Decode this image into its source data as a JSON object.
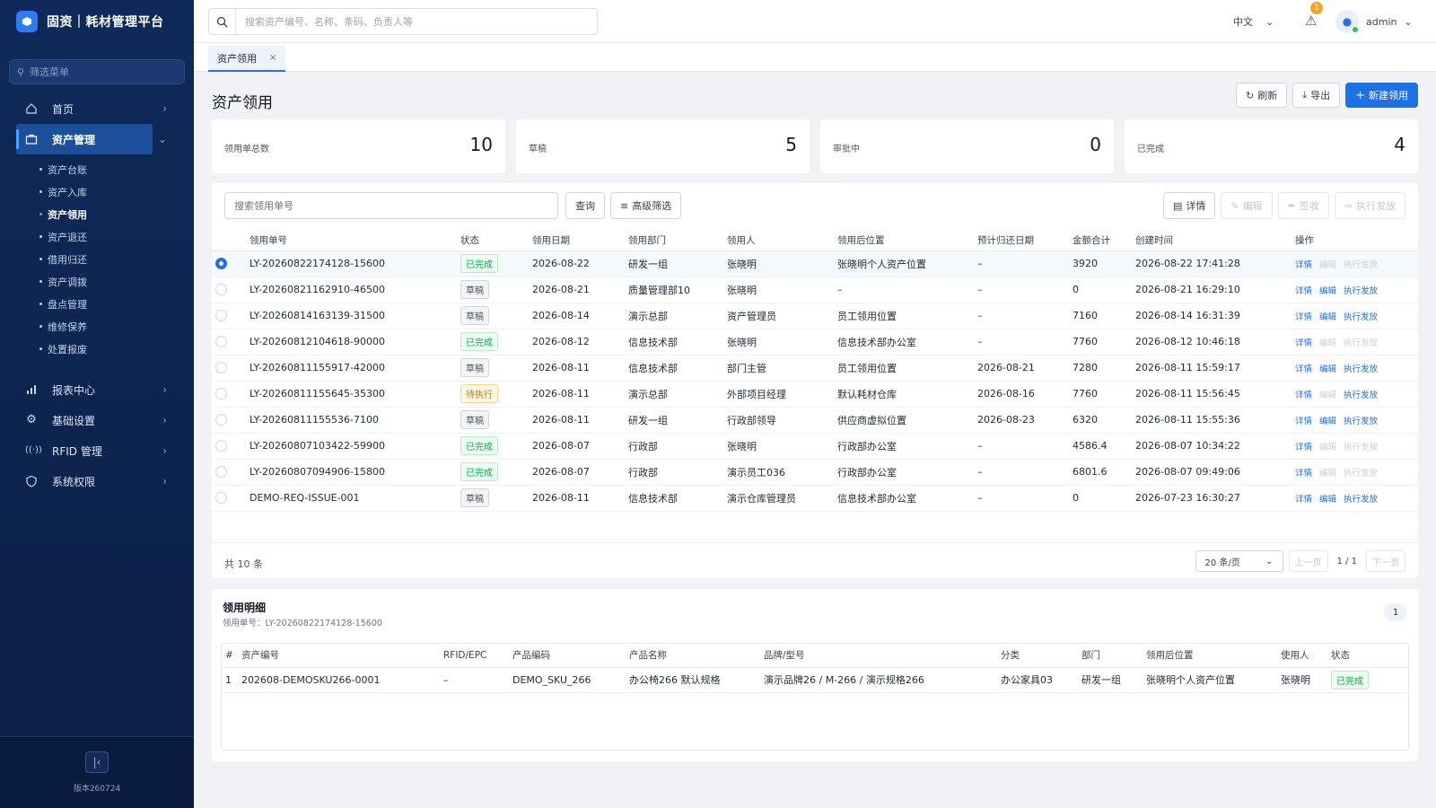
{
  "app": {
    "title": "固资｜耗材管理平台",
    "version": "版本260724"
  },
  "sidebar": {
    "filter_placeholder": "筛选菜单",
    "items": [
      {
        "label": "首页",
        "icon": "home-icon"
      },
      {
        "label": "资产管理",
        "icon": "briefcase-icon",
        "active": true
      },
      {
        "label": "报表中心",
        "icon": "bar-chart-icon"
      },
      {
        "label": "基础设置",
        "icon": "gear-icon"
      },
      {
        "label": "RFID 管理",
        "icon": "rfid-icon"
      },
      {
        "label": "系统权限",
        "icon": "shield-icon"
      }
    ],
    "sub_items": [
      "资产台账",
      "资产入库",
      "资产领用",
      "资产退还",
      "借用归还",
      "资产调拨",
      "盘点管理",
      "维修保养",
      "处置报废"
    ]
  },
  "topbar": {
    "search_placeholder": "搜索资产编号、名称、条码、负责人等",
    "language": "中文",
    "alert_count": "1",
    "user": "admin"
  },
  "tabs": [
    {
      "label": "资产领用",
      "close": "×"
    }
  ],
  "page": {
    "title": "资产领用",
    "actions": {
      "refresh": "刷新",
      "export": "导出",
      "create": "新建领用"
    }
  },
  "stats": [
    {
      "label": "领用单总数",
      "value": "10"
    },
    {
      "label": "草稿",
      "value": "5"
    },
    {
      "label": "审批中",
      "value": "0"
    },
    {
      "label": "已完成",
      "value": "4"
    }
  ],
  "filters": {
    "search_placeholder": "搜索领用单号",
    "query": "查询",
    "advanced": "高级筛选",
    "detail": "详情",
    "edit": "编辑",
    "sign": "签收",
    "issue": "执行发放"
  },
  "table": {
    "columns": [
      "领用单号",
      "状态",
      "领用日期",
      "领用部门",
      "领用人",
      "领用后位置",
      "预计归还日期",
      "金额合计",
      "创建时间",
      "操作"
    ],
    "op_labels": {
      "detail": "详情",
      "edit": "编辑",
      "issue": "执行发放"
    },
    "rows": [
      {
        "id": "LY-20260822174128-15600",
        "status": "已完成",
        "status_type": "done",
        "date": "2026-08-22",
        "dept": "研发一组",
        "person": "张晓明",
        "location": "张晓明个人资产位置",
        "return_date": "–",
        "amount": "3920",
        "created": "2026-08-22 17:41:28",
        "selected": true,
        "editable": false
      },
      {
        "id": "LY-20260821162910-46500",
        "status": "草稿",
        "status_type": "draft",
        "date": "2026-08-21",
        "dept": "质量管理部10",
        "person": "张晓明",
        "location": "–",
        "return_date": "–",
        "amount": "0",
        "created": "2026-08-21 16:29:10",
        "editable": true,
        "issuable": true
      },
      {
        "id": "LY-20260814163139-31500",
        "status": "草稿",
        "status_type": "draft",
        "date": "2026-08-14",
        "dept": "演示总部",
        "person": "资产管理员",
        "location": "员工领用位置",
        "return_date": "–",
        "amount": "7160",
        "created": "2026-08-14 16:31:39",
        "editable": true,
        "issuable": true
      },
      {
        "id": "LY-20260812104618-90000",
        "status": "已完成",
        "status_type": "done",
        "date": "2026-08-12",
        "dept": "信息技术部",
        "person": "张晓明",
        "location": "信息技术部办公室",
        "return_date": "–",
        "amount": "7760",
        "created": "2026-08-12 10:46:18",
        "editable": false
      },
      {
        "id": "LY-20260811155917-42000",
        "status": "草稿",
        "status_type": "draft",
        "date": "2026-08-11",
        "dept": "信息技术部",
        "person": "部门主管",
        "location": "员工领用位置",
        "return_date": "2026-08-21",
        "amount": "7280",
        "created": "2026-08-11 15:59:17",
        "editable": true,
        "issuable": true
      },
      {
        "id": "LY-20260811155645-35300",
        "status": "待执行",
        "status_type": "pending",
        "date": "2026-08-11",
        "dept": "演示总部",
        "person": "外部项目经理",
        "location": "默认耗材仓库",
        "return_date": "2026-08-16",
        "amount": "7760",
        "created": "2026-08-11 15:56:45",
        "editable": false,
        "issuable": true
      },
      {
        "id": "LY-20260811155536-7100",
        "status": "草稿",
        "status_type": "draft",
        "date": "2026-08-11",
        "dept": "研发一组",
        "person": "行政部领导",
        "location": "供应商虚拟位置",
        "return_date": "2026-08-23",
        "amount": "6320",
        "created": "2026-08-11 15:55:36",
        "editable": true,
        "issuable": true
      },
      {
        "id": "LY-20260807103422-59900",
        "status": "已完成",
        "status_type": "done",
        "date": "2026-08-07",
        "dept": "行政部",
        "person": "张晓明",
        "location": "行政部办公室",
        "return_date": "–",
        "amount": "4586.4",
        "created": "2026-08-07 10:34:22",
        "editable": false
      },
      {
        "id": "LY-20260807094906-15800",
        "status": "已完成",
        "status_type": "done",
        "date": "2026-08-07",
        "dept": "行政部",
        "person": "演示员工036",
        "location": "行政部办公室",
        "return_date": "–",
        "amount": "6801.6",
        "created": "2026-08-07 09:49:06",
        "editable": false
      },
      {
        "id": "DEMO-REQ-ISSUE-001",
        "status": "草稿",
        "status_type": "draft",
        "date": "2026-08-11",
        "dept": "信息技术部",
        "person": "演示仓库管理员",
        "location": "信息技术部办公室",
        "return_date": "–",
        "amount": "0",
        "created": "2026-07-23 16:30:27",
        "editable": true,
        "issuable": true
      }
    ]
  },
  "pagination": {
    "total": "共 10 条",
    "page_size": "20 条/页",
    "prev": "上一页",
    "info": "1 / 1",
    "next": "下一页"
  },
  "detail": {
    "title": "领用明细",
    "subtitle": "领用单号：LY-20260822174128-15600",
    "count": "1",
    "columns": [
      "#",
      "资产编号",
      "RFID/EPC",
      "产品编码",
      "产品名称",
      "品牌/型号",
      "分类",
      "部门",
      "领用后位置",
      "使用人",
      "状态"
    ],
    "rows": [
      {
        "no": "1",
        "asset_no": "202608-DEMOSKU266-0001",
        "rfid": "–",
        "product_code": "DEMO_SKU_266",
        "product_name": "办公椅266 默认规格",
        "brand": "演示品牌26 / M-266 / 演示规格266",
        "category": "办公家具03",
        "dept": "研发一组",
        "location": "张晓明个人资产位置",
        "user": "张晓明",
        "status": "已完成"
      }
    ]
  },
  "colors": {
    "primary": "#1f6fe5",
    "sidebar_bg": "#0f2a5a",
    "done": "#16a34a",
    "pending": "#c2790b"
  }
}
